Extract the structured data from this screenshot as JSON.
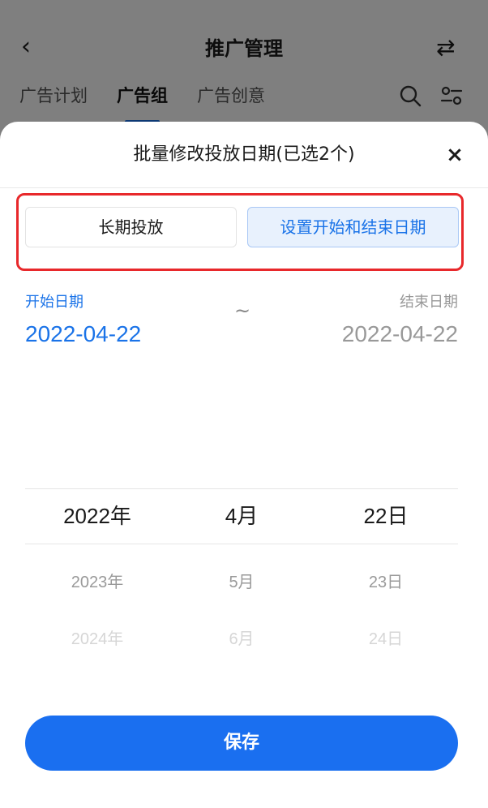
{
  "background_page": {
    "title": "推广管理",
    "tabs": [
      "广告计划",
      "广告组",
      "广告创意"
    ],
    "active_tab_index": 1
  },
  "sheet": {
    "title": "批量修改投放日期(已选2个)",
    "close_symbol": "×",
    "modes": {
      "long_term": "长期投放",
      "range": "设置开始和结束日期",
      "selected": "range"
    },
    "start": {
      "label": "开始日期",
      "value": "2022-04-22"
    },
    "separator": "~",
    "end": {
      "label": "结束日期",
      "value": "2022-04-22"
    },
    "picker": {
      "year": {
        "selected": "2022年",
        "next": "2023年",
        "far": "2024年"
      },
      "month": {
        "selected": "4月",
        "next": "5月",
        "far": "6月"
      },
      "day": {
        "selected": "22日",
        "next": "23日",
        "far": "24日"
      }
    },
    "save_label": "保存"
  },
  "colors": {
    "accent": "#1a73e8",
    "save_button": "#1a6ff0",
    "highlight_box": "#e8282b"
  }
}
